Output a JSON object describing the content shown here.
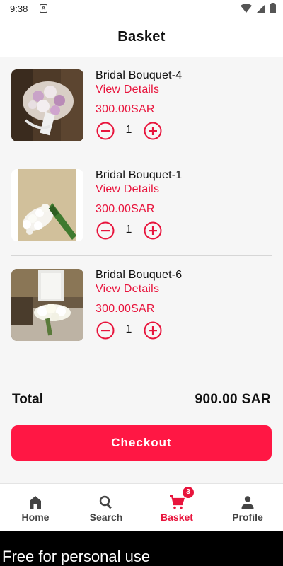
{
  "status_bar": {
    "time": "9:38",
    "notification_icon": "A"
  },
  "header": {
    "title": "Basket"
  },
  "items": [
    {
      "name": "Bridal Bouquet-4",
      "link": "View Details",
      "price": "300.00SAR",
      "quantity": "1",
      "image": "pink-white-bouquet-photo"
    },
    {
      "name": "Bridal Bouquet-1",
      "link": "View Details",
      "price": "300.00SAR",
      "quantity": "1",
      "image": "white-tulip-bouquet-photo"
    },
    {
      "name": "Bridal Bouquet-6",
      "link": "View Details",
      "price": "300.00SAR",
      "quantity": "1",
      "image": "white-calla-lily-bouquet-photo"
    }
  ],
  "total": {
    "label": "Total",
    "value": "900.00 SAR"
  },
  "checkout_label": "Checkout",
  "nav": {
    "home": "Home",
    "search": "Search",
    "basket": "Basket",
    "basket_badge": "3",
    "profile": "Profile"
  },
  "watermark": "Free for personal use",
  "colors": {
    "accent": "#e8143c",
    "button": "#ff1744",
    "background": "#f6f6f6"
  }
}
